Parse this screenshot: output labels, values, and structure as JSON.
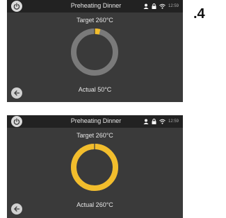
{
  "figure_label": ".4",
  "colors": {
    "accent": "#f2bd2c",
    "ring_track": "#7a7a7a",
    "screen_bg": "#3a3a3a",
    "topbar_bg": "#222222"
  },
  "screens": [
    {
      "title": "Preheating Dinner",
      "clock": "12:59",
      "target": "Target 260°C",
      "actual": "Actual 50°C",
      "progress": 0.04
    },
    {
      "title": "Preheating Dinner",
      "clock": "12:59",
      "target": "Target 260°C",
      "actual": "Actual 260°C",
      "progress": 1.0
    }
  ],
  "icons": {
    "power": "power-icon",
    "person": "person-icon",
    "lock": "lock-icon",
    "wifi": "wifi-icon",
    "back": "back-arrow-icon"
  }
}
